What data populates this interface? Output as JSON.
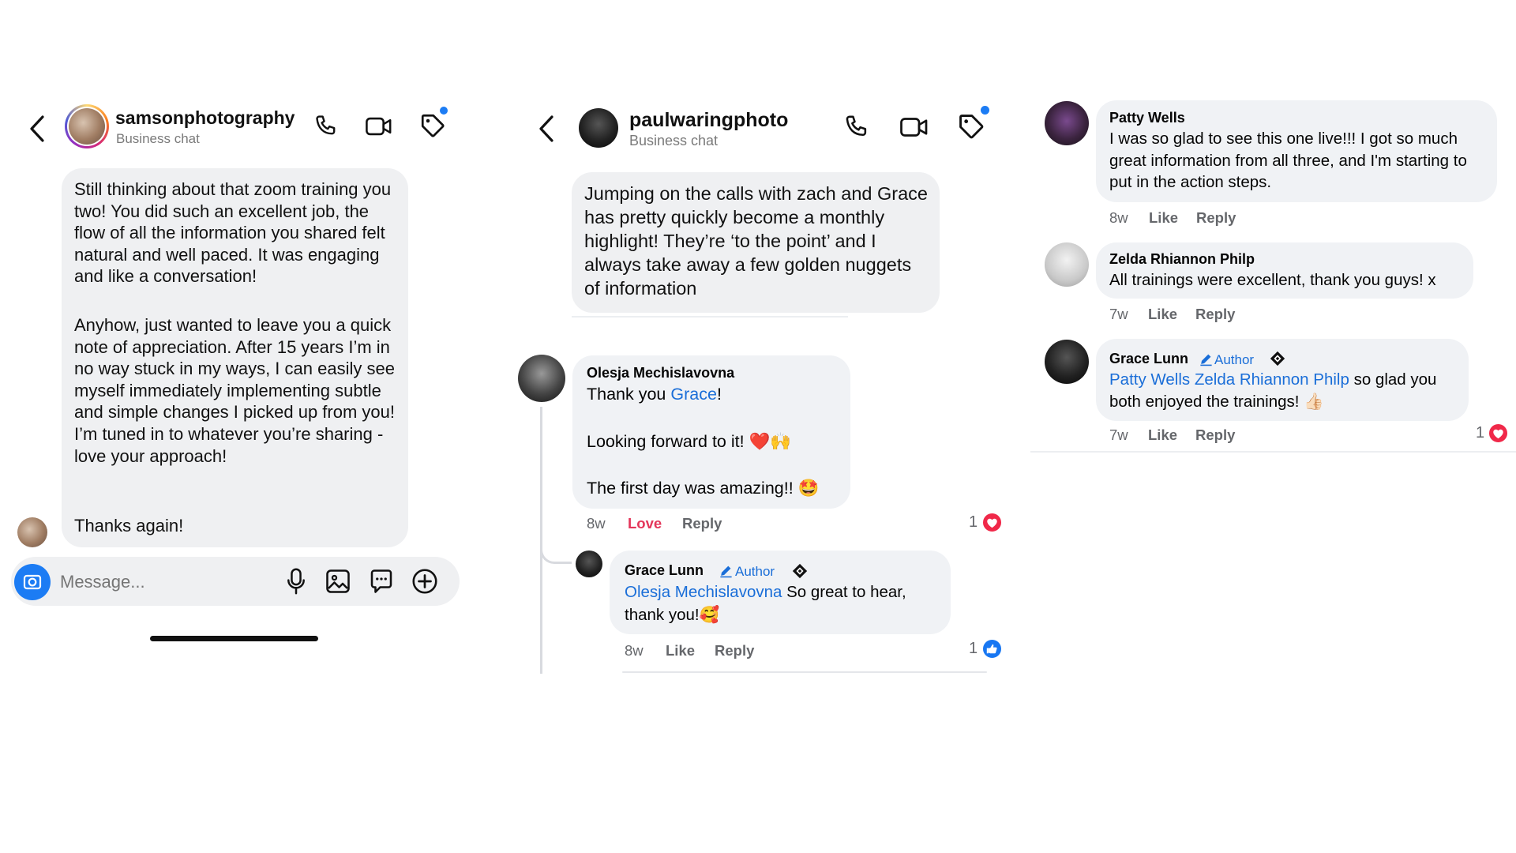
{
  "panel1": {
    "header": {
      "username": "samsonphotography",
      "subtitle": "Business chat"
    },
    "message": {
      "paragraph1": "Still thinking about that zoom training you two! You did such an excellent job, the flow of all the information you shared felt natural and well paced. It was engaging and like a conversation!",
      "paragraph2": "Anyhow, just wanted to leave you a quick note of appreciation. After 15 years I’m in no way stuck in my ways, I can easily see myself immediately implementing subtle and simple changes I picked up from you! I’m tuned in to whatever you’re sharing - love your approach!",
      "paragraph3": "Thanks again!"
    },
    "composer": {
      "placeholder": "Message..."
    }
  },
  "panel2": {
    "header": {
      "username": "paulwaringphoto",
      "subtitle": "Business chat"
    },
    "message": "Jumping on the calls with zach and Grace has pretty quickly become a monthly highlight! They’re ‘to the point’ and I always take away a few golden nuggets of information",
    "comment1": {
      "name": "Olesja Mechislavovna",
      "line1_prefix": "Thank you ",
      "line1_link": "Grace",
      "line1_suffix": "!",
      "line2": "Looking forward to it! ❤️🙌",
      "line3": "The first day was amazing!! 🤩",
      "time": "8w",
      "reaction_label": "Love",
      "reply_label": "Reply",
      "reaction_count": "1"
    },
    "reply1": {
      "name": "Grace Lunn",
      "badge": "Author",
      "mention": "Olesja Mechislavovna",
      "text_after_mention": " So great to hear,",
      "text_line2": "thank you!🥰",
      "time": "8w",
      "like_label": "Like",
      "reply_label": "Reply",
      "reaction_count": "1"
    }
  },
  "panel3": {
    "comment1": {
      "name": "Patty Wells",
      "text": "I was so glad to see this one live!!! I got so much great information from all three, and I'm starting to put in the action steps.",
      "time": "8w",
      "like_label": "Like",
      "reply_label": "Reply"
    },
    "comment2": {
      "name": "Zelda Rhiannon Philp",
      "text": "All trainings were excellent, thank you guys! x",
      "time": "7w",
      "like_label": "Like",
      "reply_label": "Reply"
    },
    "comment3": {
      "name": "Grace Lunn",
      "badge": "Author",
      "mention": "Patty Wells Zelda Rhiannon Philp",
      "text_after_mention": " so glad you",
      "text_line2": "both enjoyed the trainings! 👍🏻",
      "time": "7w",
      "like_label": "Like",
      "reply_label": "Reply",
      "reaction_count": "1"
    }
  },
  "colors": {
    "accent_blue": "#1c7cf4",
    "link_blue": "#1a6ed8",
    "love_red": "#e4365a",
    "bubble_gray": "#eff0f2"
  }
}
